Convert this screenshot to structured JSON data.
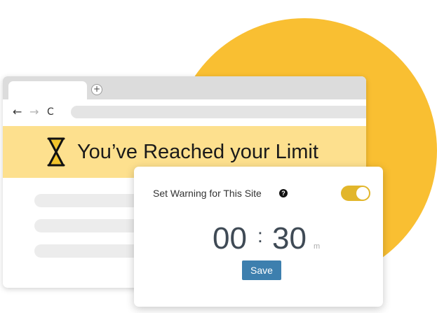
{
  "browser": {
    "new_tab_label": "+",
    "nav": {
      "back": "←",
      "forward": "→",
      "reload": "C"
    }
  },
  "banner": {
    "icon": "hourglass-icon",
    "title": "You’ve Reached your Limit"
  },
  "warning_card": {
    "label": "Set Warning for This Site",
    "help_icon_text": "?",
    "toggle_on": true,
    "time": {
      "hours": "00",
      "separator": ":",
      "minutes": "30",
      "unit": "m"
    },
    "save_label": "Save"
  },
  "colors": {
    "accent_circle": "#f9bf32",
    "banner_bg": "#fde08e",
    "toggle": "#e2b62b",
    "save_button": "#3d7fae",
    "time_text": "#3f4a55"
  }
}
